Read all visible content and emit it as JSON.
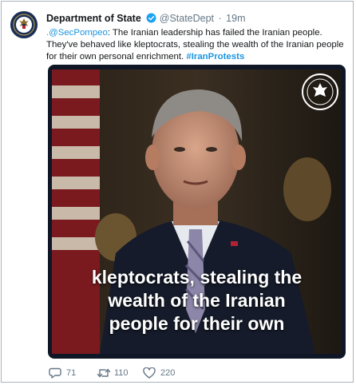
{
  "tweet": {
    "display_name": "Department of State",
    "handle": "@StateDept",
    "separator": "·",
    "time": "19m",
    "mention": ".@SecPompeo",
    "text_after_mention": ": The Iranian leadership has failed the Iranian people. They've behaved like kleptocrats, stealing the wealth of the Iranian people for their own personal enrichment. ",
    "hashtag": "#IranProtests"
  },
  "video": {
    "caption_lines": [
      "kleptocrats, stealing the",
      "wealth of the Iranian",
      "people for their own"
    ]
  },
  "actions": {
    "reply_count": "71",
    "retweet_count": "110",
    "like_count": "220"
  },
  "colors": {
    "link": "#1b95e0",
    "muted": "#657786",
    "verified": "#1da1f2"
  },
  "icons": [
    "state-department-seal-icon",
    "verified-badge-icon",
    "reply-icon",
    "retweet-icon",
    "like-icon"
  ]
}
